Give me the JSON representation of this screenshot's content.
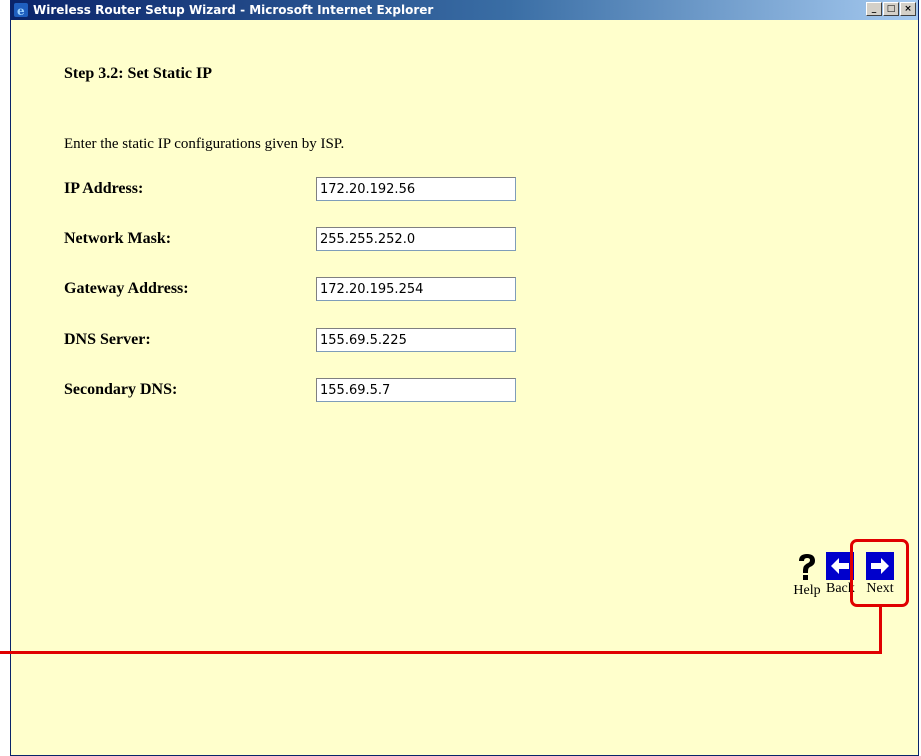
{
  "window": {
    "title": "Wireless Router Setup Wizard - Microsoft Internet Explorer",
    "controls": {
      "minimize": "_",
      "maximize": "□",
      "close": "×"
    }
  },
  "wizard": {
    "step_title": "Step 3.2: Set Static IP",
    "instruction": "Enter the static IP configurations given by ISP.",
    "fields": [
      {
        "label": "IP Address:",
        "value": "172.20.192.56"
      },
      {
        "label": "Network Mask:",
        "value": "255.255.252.0"
      },
      {
        "label": "Gateway Address:",
        "value": "172.20.195.254"
      },
      {
        "label": "DNS Server:",
        "value": "155.69.5.225"
      },
      {
        "label": "Secondary DNS:",
        "value": "155.69.5.7"
      }
    ]
  },
  "nav": {
    "help_label": "Help",
    "back_label": "Back",
    "next_label": "Next",
    "help_icon": "question-mark-icon",
    "back_icon": "arrow-left-icon",
    "next_icon": "arrow-right-icon"
  },
  "colors": {
    "page_background": "#ffffcc",
    "arrow_button": "#0000cc",
    "highlight": "#e00000"
  }
}
